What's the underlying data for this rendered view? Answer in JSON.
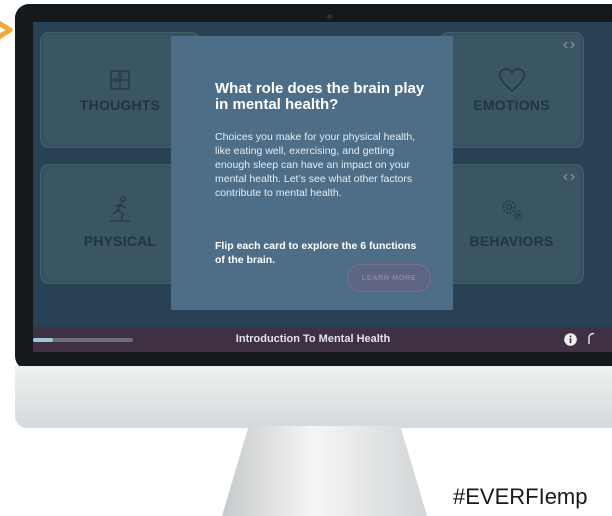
{
  "app": {
    "course_title": "Introduction To Mental Health",
    "progress_fraction": 0.2
  },
  "cards": [
    {
      "label": "THOUGHTS",
      "icon": "puzzle-head-icon"
    },
    {
      "label": "EMOTIONS",
      "icon": "heart-icon"
    },
    {
      "label": "PHYSICAL",
      "icon": "running-person-icon"
    },
    {
      "label": "BEHAVIORS",
      "icon": "gears-head-icon"
    }
  ],
  "modal": {
    "title": "What role does the brain play in mental health?",
    "body": "Choices you make for your physical health, like eating well, exercising, and getting enough sleep can have an impact on your mental health. Let’s see what other factors contribute to mental health.",
    "cta": "Flip each card to explore the 6 functions of the brain.",
    "button_label": "LEARN MORE"
  },
  "hashtag": "#EVERFIemp",
  "colors": {
    "accent": "#f2a93b",
    "screen_bg": "#2f4a5f",
    "modal_bg": "#4e6e88",
    "bottom_bar": "#3f3143"
  }
}
